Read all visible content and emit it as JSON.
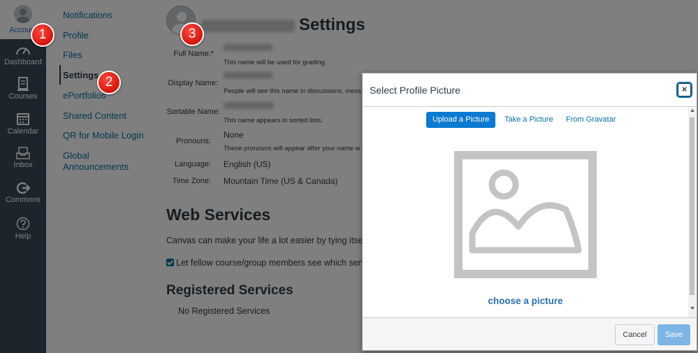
{
  "global_nav": [
    {
      "label": "Account",
      "icon": "account-avatar-icon"
    },
    {
      "label": "Dashboard",
      "icon": "dashboard-icon"
    },
    {
      "label": "Courses",
      "icon": "courses-icon"
    },
    {
      "label": "Calendar",
      "icon": "calendar-icon"
    },
    {
      "label": "Inbox",
      "icon": "inbox-icon"
    },
    {
      "label": "Commons",
      "icon": "commons-icon"
    },
    {
      "label": "Help",
      "icon": "help-icon"
    }
  ],
  "sub_nav": [
    {
      "label": "Notifications"
    },
    {
      "label": "Profile"
    },
    {
      "label": "Files"
    },
    {
      "label": "Settings",
      "active": true
    },
    {
      "label": "ePortfolios"
    },
    {
      "label": "Shared Content"
    },
    {
      "label": "QR for Mobile Login"
    },
    {
      "label": "Global Announcements"
    }
  ],
  "page": {
    "title": "Settings",
    "fields": [
      {
        "label": "Full Name:*",
        "help": "This name will be used for grading."
      },
      {
        "label": "Display Name:",
        "help": "People will see this name in discussions, mess"
      },
      {
        "label": "Sortable Name:",
        "help": "This name appears in sorted lists."
      },
      {
        "label": "Pronouns:",
        "value": "None",
        "help": "These pronouns will appear after your name w"
      },
      {
        "label": "Language:",
        "value": "English (US)"
      },
      {
        "label": "Time Zone:",
        "value": "Mountain Time (US & Canada)"
      }
    ],
    "web_services_heading": "Web Services",
    "web_services_desc": "Canvas can make your life a lot easier by tying itsel",
    "checkbox_label": "Let fellow course/group members see which serv",
    "registered_heading": "Registered Services",
    "no_registered": "No Registered Services"
  },
  "dialog": {
    "title": "Select Profile Picture",
    "close_glyph": "×",
    "tabs": [
      {
        "label": "Upload a Picture",
        "active": true
      },
      {
        "label": "Take a Picture"
      },
      {
        "label": "From Gravatar"
      }
    ],
    "choose_link": "choose a picture",
    "cancel_label": "Cancel",
    "save_label": "Save"
  },
  "callouts": [
    "1",
    "2",
    "3"
  ],
  "colors": {
    "nav_bg": "#394b58",
    "link": "#0770a3",
    "primary_button": "#0b7ad1",
    "badge_red": "#e0241b"
  }
}
